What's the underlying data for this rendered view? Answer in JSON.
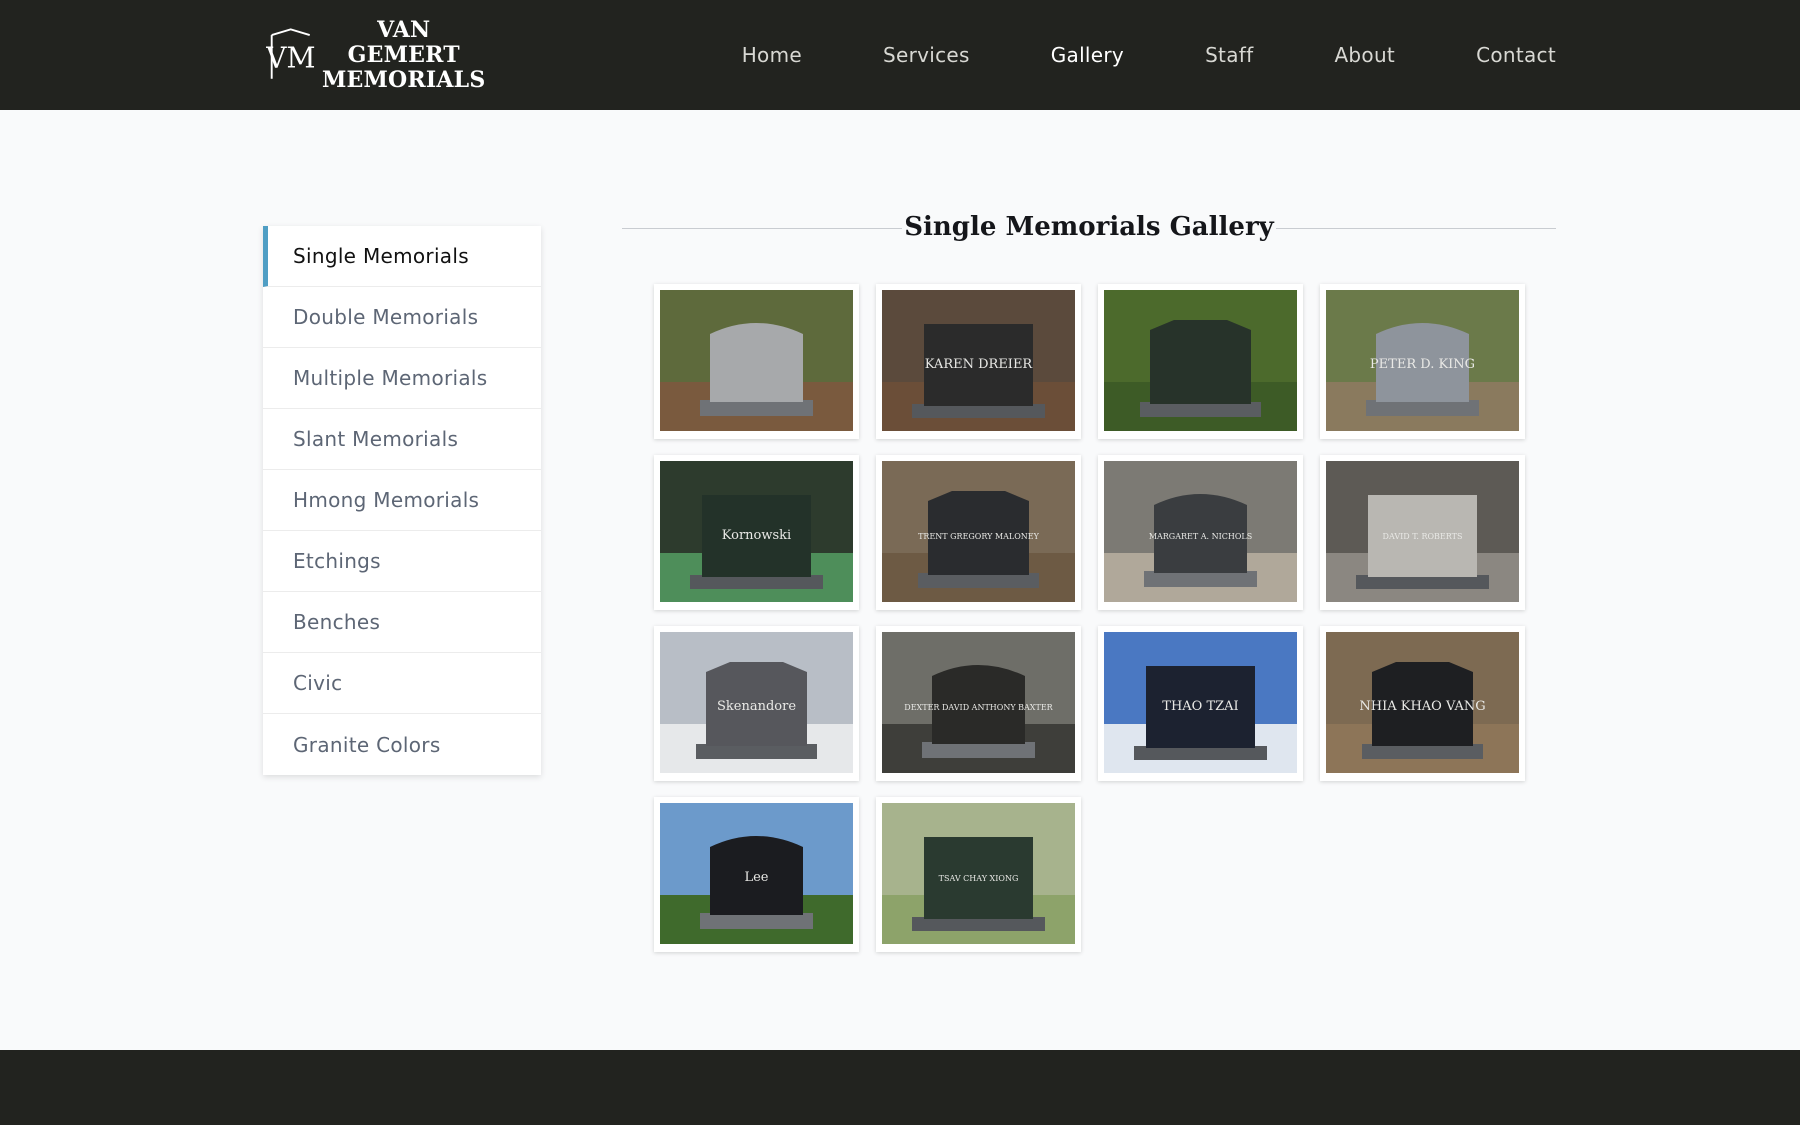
{
  "brand": {
    "line1": "VAN GEMERT",
    "line2": "MEMORIALS",
    "mark": "VM"
  },
  "nav": [
    {
      "label": "Home"
    },
    {
      "label": "Services"
    },
    {
      "label": "Gallery"
    },
    {
      "label": "Staff"
    },
    {
      "label": "About"
    },
    {
      "label": "Contact"
    }
  ],
  "sidebar": [
    {
      "label": "Single Memorials"
    },
    {
      "label": "Double Memorials"
    },
    {
      "label": "Multiple Memorials"
    },
    {
      "label": "Slant Memorials"
    },
    {
      "label": "Hmong Memorials"
    },
    {
      "label": "Etchings"
    },
    {
      "label": "Benches"
    },
    {
      "label": "Civic"
    },
    {
      "label": "Granite Colors"
    }
  ],
  "gallery": {
    "title": "Single Memorials Gallery",
    "photos": [
      {
        "sky": "#5e6a3c",
        "ground": "#7a5a3e",
        "stone": "#a7a9ab",
        "text": ""
      },
      {
        "sky": "#5b4a3c",
        "ground": "#6b4e38",
        "stone": "#2b2b2b",
        "text": "KAREN DREIER"
      },
      {
        "sky": "#4c6a2c",
        "ground": "#3d5b26",
        "stone": "#27332a",
        "text": ""
      },
      {
        "sky": "#6b7a4a",
        "ground": "#8a7a5e",
        "stone": "#8e949c",
        "text": "PETER D. KING"
      },
      {
        "sky": "#2d3b2d",
        "ground": "#4e8e5a",
        "stone": "#233229",
        "text": "Kornowski"
      },
      {
        "sky": "#7a6a56",
        "ground": "#6d5a44",
        "stone": "#2a2c2f",
        "text": "TRENT GREGORY MALONEY"
      },
      {
        "sky": "#7c7a74",
        "ground": "#b0a89a",
        "stone": "#3a3d40",
        "text": "MARGARET A. NICHOLS"
      },
      {
        "sky": "#5d5a55",
        "ground": "#8b8781",
        "stone": "#b9b7b2",
        "text": "DAVID T. ROBERTS"
      },
      {
        "sky": "#b8bec6",
        "ground": "#e6e8ea",
        "stone": "#56575c",
        "text": "Skenandore"
      },
      {
        "sky": "#6e6e68",
        "ground": "#3e3e3a",
        "stone": "#2a2a28",
        "text": "DEXTER DAVID ANTHONY BAXTER"
      },
      {
        "sky": "#4a78c2",
        "ground": "#dfe6ef",
        "stone": "#1c2230",
        "text": "THAO TZAI"
      },
      {
        "sky": "#7d6a52",
        "ground": "#8d7558",
        "stone": "#1e1f22",
        "text": "NHIA KHAO VANG"
      },
      {
        "sky": "#6c9acb",
        "ground": "#3f6a2c",
        "stone": "#1b1c20",
        "text": "Lee"
      },
      {
        "sky": "#a7b38d",
        "ground": "#8da36a",
        "stone": "#2a3a30",
        "text": "TSAV CHAY XIONG"
      }
    ]
  }
}
